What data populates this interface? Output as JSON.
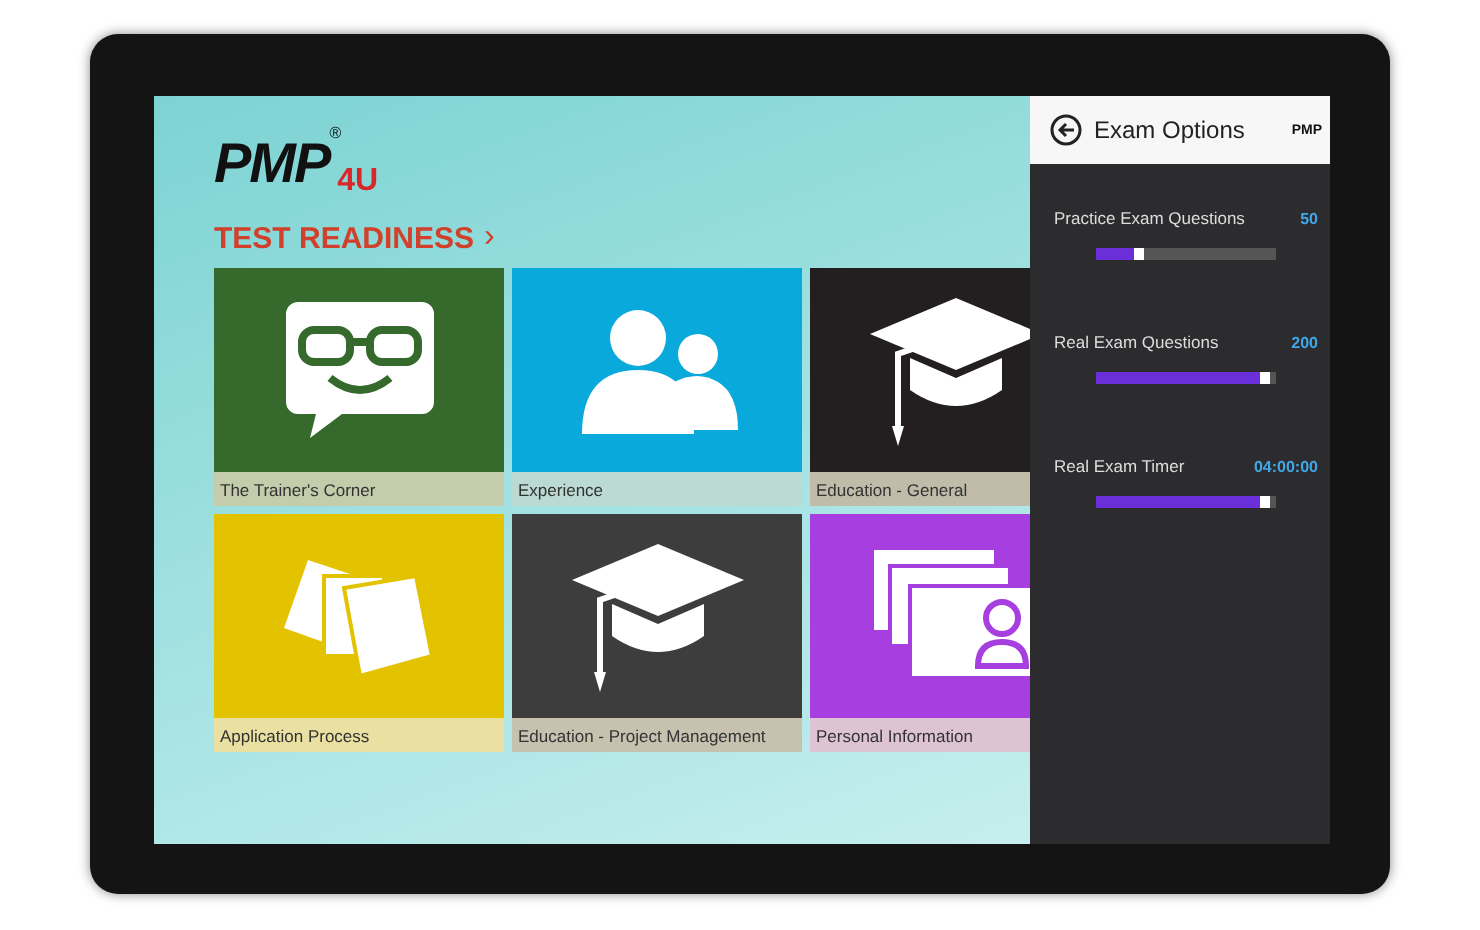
{
  "logo": {
    "main": "PMP",
    "suffix": "4U",
    "mark": "®"
  },
  "section": {
    "title": "TEST READINESS",
    "chevron": "›"
  },
  "tiles": [
    {
      "label": "The Trainer's Corner",
      "kind": "trainer",
      "color": "#356a2c"
    },
    {
      "label": "Experience",
      "kind": "people",
      "color": "#0aa9dc"
    },
    {
      "label": "Education - General",
      "kind": "cap",
      "color": "#231f20"
    },
    {
      "label": "Application Process",
      "kind": "papers",
      "color": "#e3c200"
    },
    {
      "label": "Education - Project Management",
      "kind": "cap",
      "color": "#3d3d3d"
    },
    {
      "label": "Personal Information",
      "kind": "cards",
      "color": "#a63ee0"
    }
  ],
  "panel": {
    "title": "Exam Options",
    "logo": "PMP",
    "options": [
      {
        "label": "Practice Exam Questions",
        "value": "50",
        "level": 0.22
      },
      {
        "label": "Real Exam Questions",
        "value": "200",
        "level": 0.97
      },
      {
        "label": "Real Exam Timer",
        "value": "04:00:00",
        "level": 0.97
      }
    ]
  }
}
